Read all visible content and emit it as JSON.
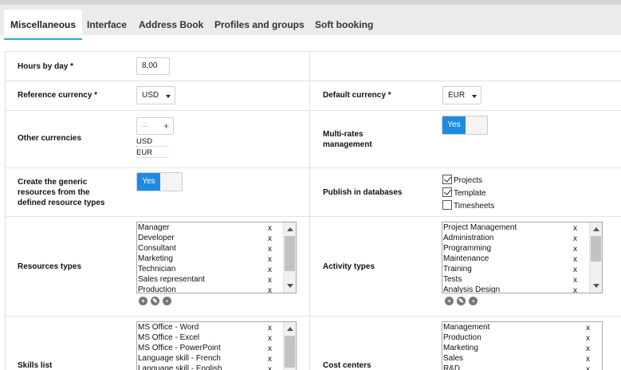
{
  "tabs": [
    {
      "label": "Miscellaneous",
      "active": true
    },
    {
      "label": "Interface"
    },
    {
      "label": "Address Book"
    },
    {
      "label": "Profiles and groups"
    },
    {
      "label": "Soft booking"
    }
  ],
  "hours_by_day": {
    "label": "Hours by day *",
    "value": "8,00"
  },
  "reference_currency": {
    "label": "Reference currency *",
    "value": "USD"
  },
  "default_currency": {
    "label": "Default currency *",
    "value": "EUR"
  },
  "other_currencies": {
    "label": "Other currencies",
    "placeholder": "...",
    "add": "+",
    "items": [
      "USD",
      "EUR"
    ]
  },
  "multi_rates": {
    "label_line1": "Multi-rates",
    "label_line2": "management",
    "toggle": "Yes"
  },
  "generic_resources": {
    "label_line1": "Create the generic",
    "label_line2": "resources from the",
    "label_line3": "defined resource types",
    "toggle": "Yes"
  },
  "publish": {
    "label": "Publish in databases",
    "options": [
      {
        "label": "Projects",
        "checked": true
      },
      {
        "label": "Template",
        "checked": true
      },
      {
        "label": "Timesheets",
        "checked": false
      }
    ]
  },
  "resources_types": {
    "label": "Resources types",
    "items": [
      "Manager",
      "Developer",
      "Consultant",
      "Marketing",
      "Technician",
      "Sales representant",
      "Production"
    ],
    "remove": "x"
  },
  "activity_types": {
    "label": "Activity types",
    "items": [
      "Project Management",
      "Administration",
      "Programming",
      "Maintenance",
      "Training",
      "Tests",
      "Analysis Design"
    ],
    "remove": "x"
  },
  "skills_list": {
    "label": "Skills list",
    "items": [
      "MS Office - Word",
      "MS Office - Excel",
      "MS Office - PowerPoint",
      "Language skill - French",
      "Language skill - English"
    ],
    "remove": "x"
  },
  "cost_centers": {
    "label": "Cost centers",
    "items": [
      "Management",
      "Production",
      "Marketing",
      "Sales",
      "R&D"
    ],
    "remove": "x"
  },
  "list_actions": {
    "add_icon": "plus-icon",
    "edit_icon": "pencil-icon",
    "stats_icon": "chart-icon"
  },
  "colors": {
    "accent": "#1e8be0",
    "tab_underline": "#2aa6e0",
    "topbar": "#ebebeb"
  }
}
